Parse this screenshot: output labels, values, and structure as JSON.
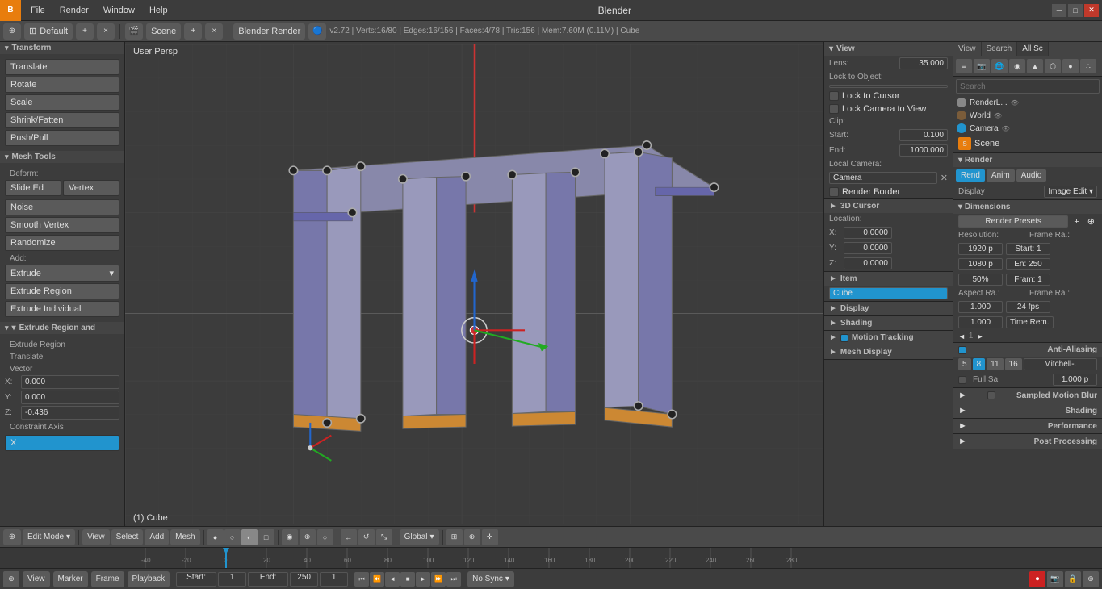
{
  "window": {
    "title": "Blender",
    "logo": "B",
    "info_text": "v2.72 | Verts:16/80 | Edges:16/156 | Faces:4/78 | Tris:156 | Mem:7.60M (0.11M) | Cube"
  },
  "menu": {
    "items": [
      "File",
      "Render",
      "Window",
      "Help"
    ]
  },
  "header": {
    "layout_icon": "⊞",
    "layout_name": "Default",
    "scene_icon": "🎬",
    "scene_name": "Scene",
    "render_engine": "Blender Render",
    "add_btn": "+",
    "remove_btn": "×"
  },
  "viewport": {
    "label": "User Persp",
    "mode": "Edit Mode",
    "object_name": "(1) Cube"
  },
  "left_panel": {
    "transform_header": "Transform",
    "tools": {
      "translate": "Translate",
      "rotate": "Rotate",
      "scale": "Scale",
      "shrink_fatten": "Shrink/Fatten",
      "push_pull": "Push/Pull"
    },
    "mesh_tools_header": "Mesh Tools",
    "deform_label": "Deform:",
    "slide_edge": "Slide Ed",
    "vertex": "Vertex",
    "noise": "Noise",
    "smooth_vertex": "Smooth Vertex",
    "randomize": "Randomize",
    "add_label": "Add:",
    "extrude": "Extrude",
    "extrude_region": "Extrude Region",
    "extrude_individual": "Extrude Individual",
    "extrude_region_and": "Extrude Region and",
    "extrude_region2": "Extrude Region",
    "translate": "Translate",
    "vector_label": "Vector",
    "x_val": "0.000",
    "y_val": "0.000",
    "z_val": "-0.436",
    "constraint_axis": "Constraint Axis",
    "x_axis": "X"
  },
  "right_panel": {
    "view_header": "View",
    "lens_label": "Lens:",
    "lens_value": "35.000",
    "lock_to_object": "Lock to Object:",
    "lock_to_cursor": "Lock to Cursor",
    "lock_camera_to_view": "Lock Camera to View",
    "clip_label": "Clip:",
    "start_label": "Start:",
    "start_value": "0.100",
    "end_label": "End:",
    "end_value": "1000.000",
    "local_camera": "Local Camera:",
    "camera_value": "Camera",
    "render_border": "Render Border",
    "cursor_3d": "3D Cursor",
    "location_label": "Location:",
    "x_label": "X:",
    "x_value": "0.0000",
    "y_label": "Y:",
    "y_value": "0.0000",
    "z_label": "Z:",
    "z_value": "0.0000",
    "item_header": "Item",
    "cube_label": "Cube",
    "display_header": "Display",
    "shading_header": "Shading",
    "motion_tracking_header": "Motion Tracking",
    "mesh_display_header": "Mesh Display"
  },
  "far_right": {
    "tab_view": "View",
    "tab_search": "Search",
    "tab_all": "All Sc",
    "scene_label": "Scene",
    "render_label": "Render",
    "tab_rend": "Rend",
    "tab_anim": "Anim",
    "tab_audio": "Audio",
    "display_label": "Display",
    "display_value": "Image Edit ▾",
    "dimensions_header": "Dimensions",
    "render_presets": "Render Presets",
    "resolution_label": "Resolution:",
    "frame_ra_label": "Frame Ra.:",
    "res_x": "1920 p",
    "res_y": "1080 p",
    "percent": "50%",
    "start_val": "Start: 1",
    "end_val": "En: 250",
    "frame_val": "Fram: 1",
    "aspect_ra": "Aspect Ra.:",
    "frame_ra2": "Frame Ra.:",
    "aspect_x": "1.000",
    "aspect_y": "1.000",
    "fps": "24 fps",
    "time_rem": "Time Rem.",
    "aa_header": "Anti-Aliasing",
    "aa_vals": [
      "5",
      "8",
      "11",
      "16"
    ],
    "aa_filter": "Mitchell-.",
    "full_sa": "Full Sa",
    "aa_samples": "1.000 p",
    "sampled_motion": "Sampled Motion Blur",
    "shading_section": "Shading",
    "performance_section": "Performance",
    "post_processing": "Post Processing"
  },
  "bottom_toolbar": {
    "mode": "Edit Mode",
    "menu_items": [
      "View",
      "Select",
      "Add",
      "Mesh"
    ],
    "shading_modes": [
      "●",
      "○",
      "◐",
      "□"
    ],
    "pivot": "Global"
  },
  "timeline": {
    "markers": [
      -40,
      -20,
      0,
      20,
      40,
      60,
      80,
      100,
      120,
      140,
      160,
      180,
      200,
      220,
      240,
      260,
      280
    ],
    "start": "Start:",
    "start_val": "1",
    "end": "End:",
    "end_val": "250",
    "current": "1",
    "sync": "No Sync"
  },
  "status_bar": {
    "items": [
      "View",
      "Marker",
      "Frame",
      "Playback"
    ]
  }
}
